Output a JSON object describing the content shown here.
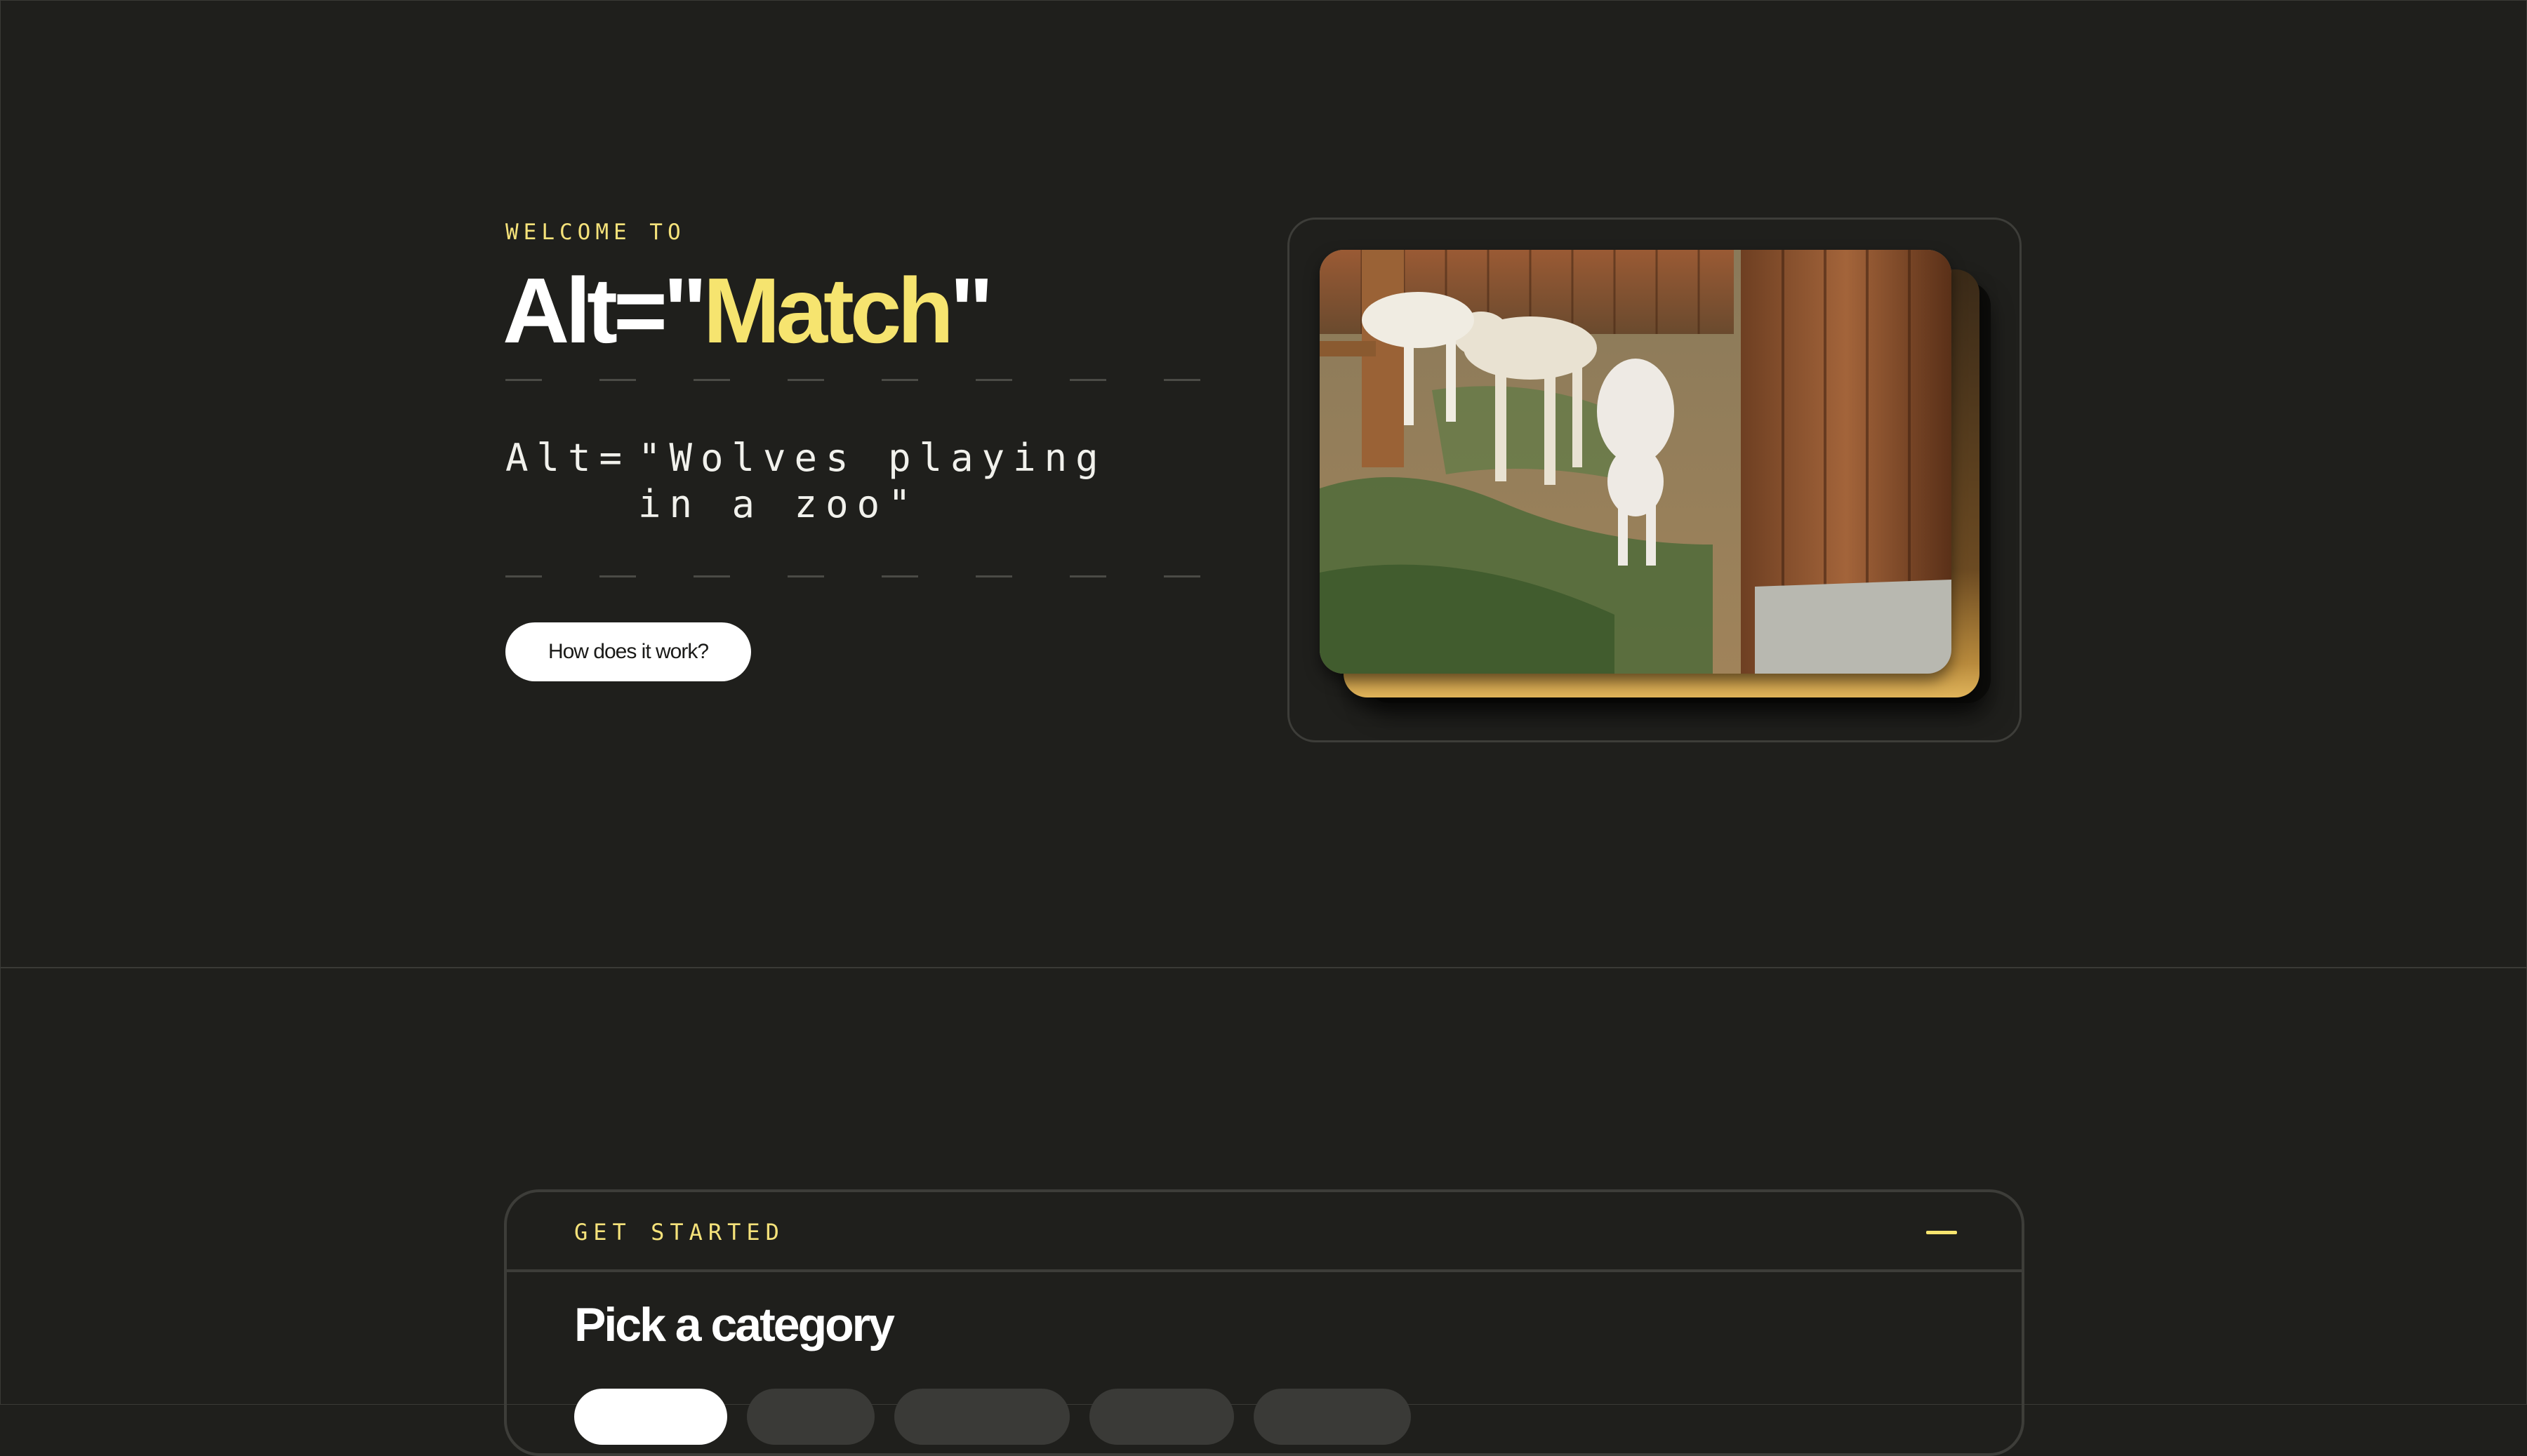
{
  "hero": {
    "eyebrow": "WELCOME TO",
    "title_prefix": "Alt=\"",
    "title_accent": "Match",
    "title_suffix": "\"",
    "alt_prefix": "Alt=",
    "alt_text": "\"Wolves playing in a zoo\"",
    "cta_label": "How does it work?",
    "image_subject": "Wolves playing in a zoo"
  },
  "panel": {
    "label": "GET STARTED",
    "collapse_icon": "minus-icon",
    "title": "Pick a category",
    "categories": [
      {
        "label": "",
        "active": true
      },
      {
        "label": "",
        "active": false
      },
      {
        "label": "",
        "active": false
      },
      {
        "label": "",
        "active": false
      },
      {
        "label": "",
        "active": false
      }
    ]
  },
  "colors": {
    "background": "#1f1f1c",
    "accent": "#f6e46f",
    "border": "#3d3d39",
    "text": "#ffffff"
  }
}
